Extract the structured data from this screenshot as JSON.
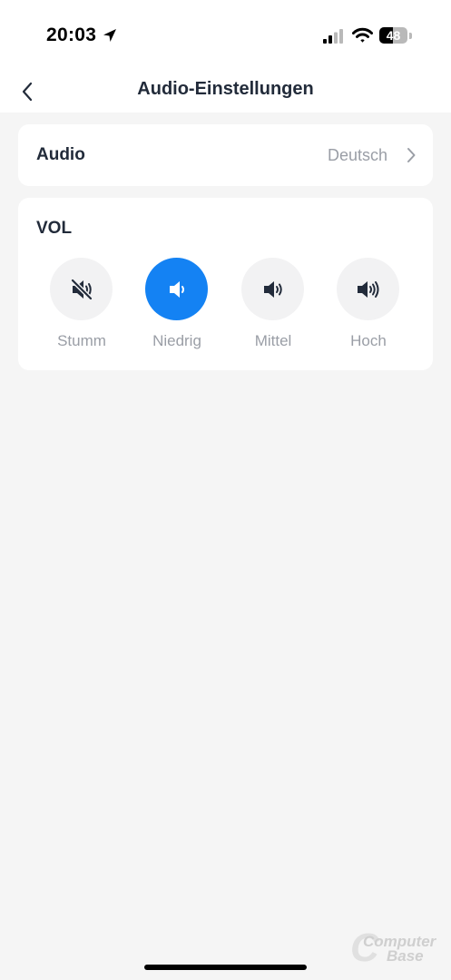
{
  "status_bar": {
    "time": "20:03",
    "battery": "48",
    "battery_level": 0.48
  },
  "nav": {
    "title": "Audio-Einstellungen"
  },
  "audio": {
    "label": "Audio",
    "value": "Deutsch"
  },
  "volume": {
    "title": "VOL",
    "selected": "Niedrig",
    "options": [
      {
        "label": "Stumm",
        "icon": "speaker-muted-icon"
      },
      {
        "label": "Niedrig",
        "icon": "speaker-low-icon"
      },
      {
        "label": "Mittel",
        "icon": "speaker-medium-icon"
      },
      {
        "label": "Hoch",
        "icon": "speaker-high-icon"
      }
    ]
  },
  "watermark": {
    "line1": "Computer",
    "line2": "Base"
  },
  "colors": {
    "accent": "#1482f3",
    "text": "#222b3a",
    "muted": "#9a9ea6",
    "background": "#f5f5f5"
  }
}
